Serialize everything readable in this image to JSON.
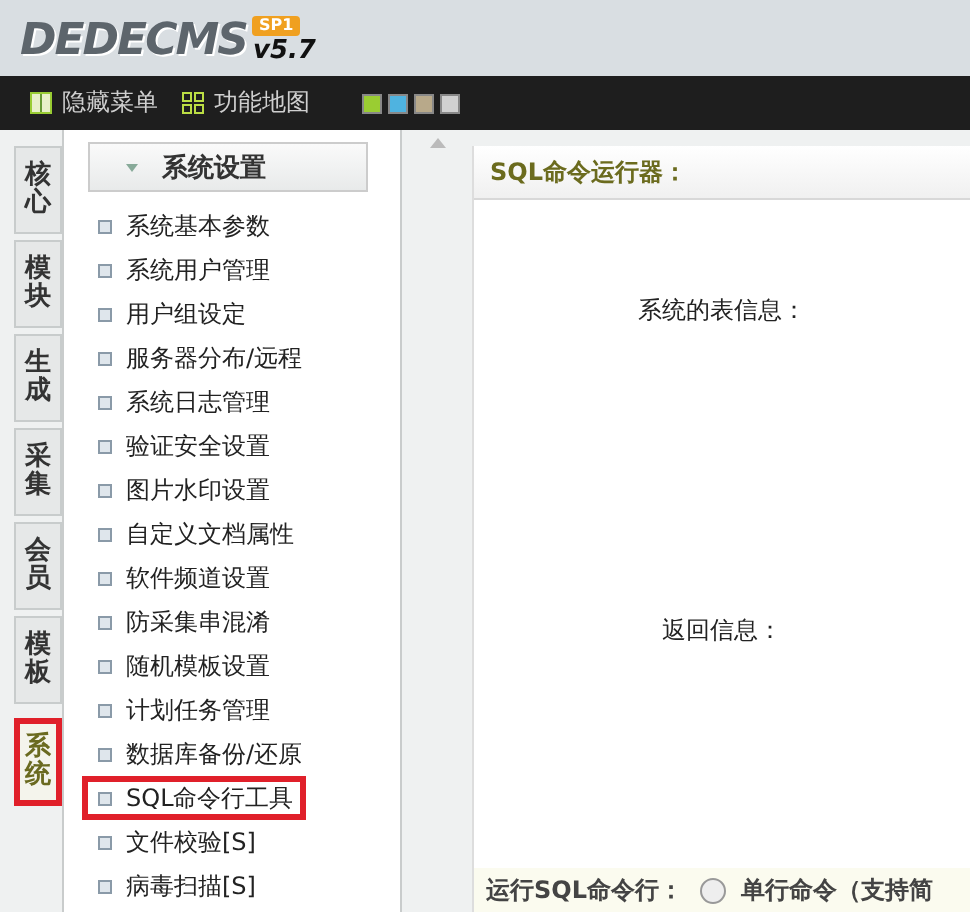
{
  "header": {
    "logo": "DEDECMS",
    "badge": "SP1",
    "version": "v5.7"
  },
  "toolbar": {
    "links": [
      {
        "label": "隐藏菜单",
        "kind": "columns"
      },
      {
        "label": "功能地图",
        "kind": "grid"
      }
    ],
    "skins": [
      {
        "color": "#9acd32"
      },
      {
        "color": "#4fb3e0"
      },
      {
        "color": "#b8a98a"
      },
      {
        "color": "#d0d0d0"
      }
    ]
  },
  "side_tabs": [
    {
      "label": "核心",
      "selected": false,
      "highlighted": false
    },
    {
      "label": "模块",
      "selected": false,
      "highlighted": false
    },
    {
      "label": "生成",
      "selected": false,
      "highlighted": false
    },
    {
      "label": "采集",
      "selected": false,
      "highlighted": false
    },
    {
      "label": "会员",
      "selected": false,
      "highlighted": false
    },
    {
      "label": "模板",
      "selected": false,
      "highlighted": false
    },
    {
      "label": "系统",
      "selected": true,
      "highlighted": true
    }
  ],
  "menu": {
    "title": "系统设置",
    "expanded": true,
    "items": [
      {
        "label": "系统基本参数",
        "highlighted": false
      },
      {
        "label": "系统用户管理",
        "highlighted": false
      },
      {
        "label": "用户组设定",
        "highlighted": false
      },
      {
        "label": "服务器分布/远程",
        "highlighted": false
      },
      {
        "label": "系统日志管理",
        "highlighted": false
      },
      {
        "label": "验证安全设置",
        "highlighted": false
      },
      {
        "label": "图片水印设置",
        "highlighted": false
      },
      {
        "label": "自定义文档属性",
        "highlighted": false
      },
      {
        "label": "软件频道设置",
        "highlighted": false
      },
      {
        "label": "防采集串混淆",
        "highlighted": false
      },
      {
        "label": "随机模板设置",
        "highlighted": false
      },
      {
        "label": "计划任务管理",
        "highlighted": false
      },
      {
        "label": "数据库备份/还原",
        "highlighted": false
      },
      {
        "label": "SQL命令行工具",
        "highlighted": true
      },
      {
        "label": "文件校验[S]",
        "highlighted": false
      },
      {
        "label": "病毒扫描[S]",
        "highlighted": false
      }
    ]
  },
  "panel": {
    "title": "SQL命令运行器：",
    "table_info_label": "系统的表信息：",
    "result_label": "返回信息：",
    "run_row": {
      "label": "运行SQL命令行：",
      "option": {
        "label": "单行命令（支持简",
        "selected": false
      }
    }
  }
}
